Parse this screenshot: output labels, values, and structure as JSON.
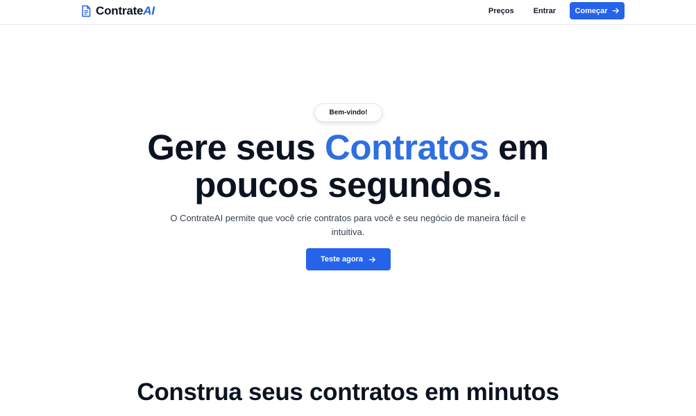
{
  "nav": {
    "brand_main": "Contrate",
    "brand_accent": "AI",
    "links": [
      "Preços",
      "Entrar"
    ],
    "cta_label": "Começar"
  },
  "hero": {
    "badge": "Bem-vindo!",
    "title_part1": "Gere seus ",
    "title_accent": "Contratos",
    "title_part2": " em",
    "title_line2": "poucos segundos.",
    "subtitle": "O ContrateAI permite que você crie contratos para você e seu negócio de maneira fácil e intuitiva.",
    "cta_label": "Teste agora"
  },
  "section": {
    "title": "Construa seus contratos em minutos"
  },
  "colors": {
    "accent": "#2563eb",
    "text": "#0b1220",
    "muted": "#374151",
    "border": "#e7e8ec"
  },
  "icons": {
    "brand": "document-icon",
    "cta": "arrow-right-icon"
  }
}
